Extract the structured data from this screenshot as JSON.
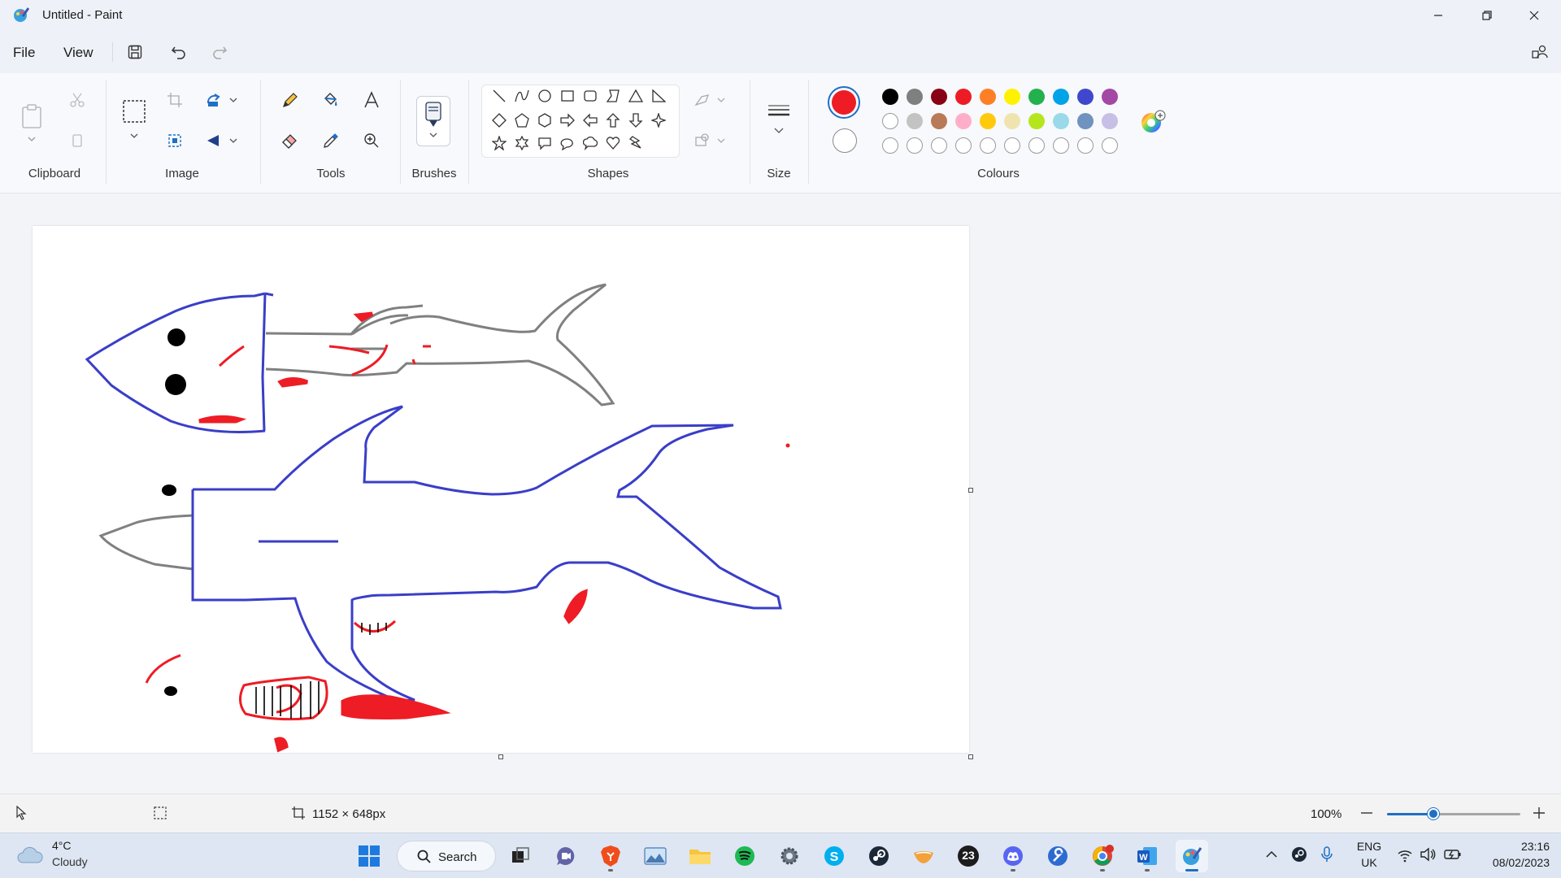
{
  "window": {
    "title": "Untitled - Paint"
  },
  "menu": {
    "file": "File",
    "view": "View"
  },
  "ribbon": {
    "groups": {
      "clipboard": "Clipboard",
      "image": "Image",
      "tools": "Tools",
      "brushes": "Brushes",
      "shapes": "Shapes",
      "size": "Size",
      "colours": "Colours"
    },
    "primary_color": "#ee1c24",
    "secondary_color": "#ffffff",
    "palette_row1": [
      "#000000",
      "#7f7f7f",
      "#880015",
      "#ed1c24",
      "#ff7f27",
      "#fff200",
      "#22b14c",
      "#00a2e8",
      "#3f48cc",
      "#a349a4"
    ],
    "palette_row2": [
      "#ffffff",
      "#c3c3c3",
      "#b97a57",
      "#ffaec9",
      "#ffc90e",
      "#efe4b0",
      "#b5e61d",
      "#99d9ea",
      "#7092be",
      "#c8bfe7"
    ]
  },
  "drawing": {
    "colors": {
      "outline": "#3a3ec8",
      "tint": "#808080",
      "accent": "#ee1c24",
      "eye": "#000000"
    }
  },
  "status": {
    "canvas_size": "1152 × 648px",
    "zoom": "100%",
    "zoom_fraction": 0.35
  },
  "taskbar": {
    "weather_temp": "4°C",
    "weather_cond": "Cloudy",
    "search_label": "Search",
    "lang": "ENG",
    "region": "UK",
    "time": "23:16",
    "date": "08/02/2023",
    "notification_badge": "23"
  }
}
